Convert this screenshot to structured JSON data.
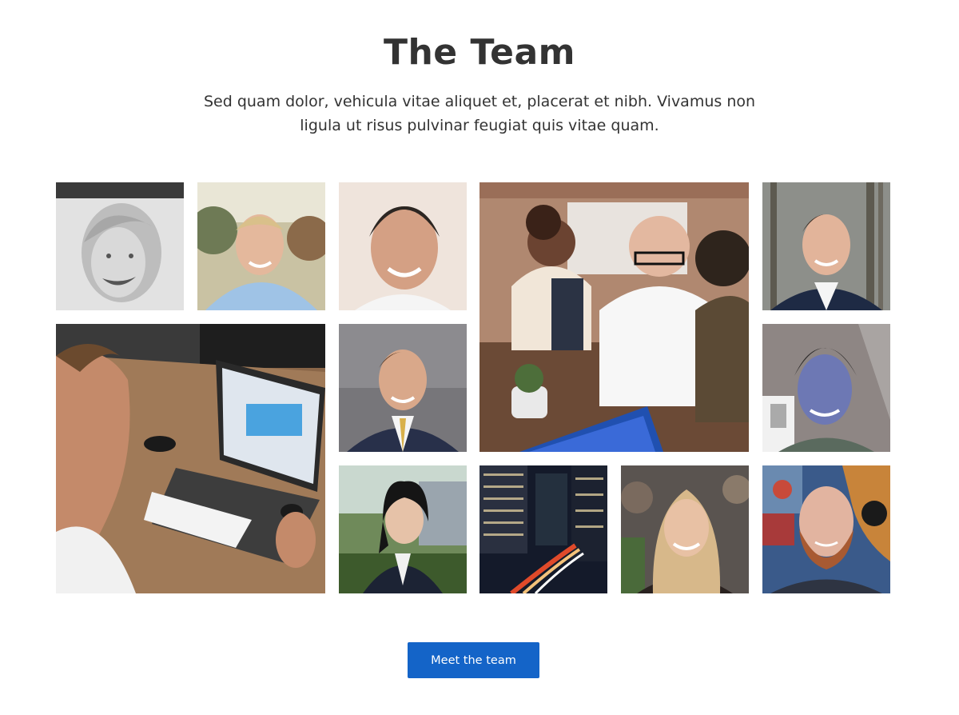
{
  "section": {
    "title": "The Team",
    "description": "Sed quam dolor, vehicula vitae aliquet et, placerat et nibh. Vivamus non ligula ut risus pulvinar feugiat quis vitae quam."
  },
  "photos": [
    {
      "subject": "portrait-woman-grayscale"
    },
    {
      "subject": "portrait-man-blue-shirt"
    },
    {
      "subject": "portrait-man-smiling"
    },
    {
      "subject": "team-meeting-group"
    },
    {
      "subject": "portrait-man-navy-suit"
    },
    {
      "subject": "laptop-workspace"
    },
    {
      "subject": "portrait-man-suit-tie"
    },
    {
      "subject": "portrait-man-selfie"
    },
    {
      "subject": "portrait-woman-blazer"
    },
    {
      "subject": "city-night-traffic"
    },
    {
      "subject": "portrait-woman-blonde"
    },
    {
      "subject": "portrait-man-beard"
    }
  ],
  "cta": {
    "label": "Meet the team",
    "color": "#1464c8"
  }
}
